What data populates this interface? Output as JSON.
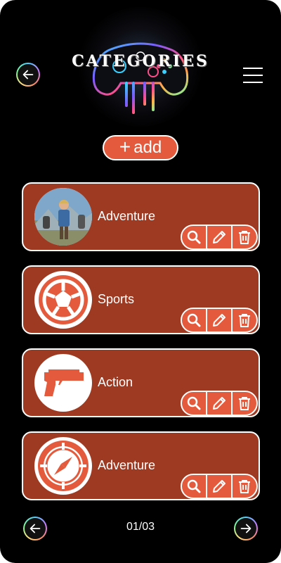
{
  "header": {
    "title": "CATEGORIES",
    "back_icon": "arrow-left-circle-icon",
    "menu_icon": "hamburger-menu-icon",
    "art": "gamepad-art"
  },
  "add_button": {
    "label": "add",
    "icon": "plus-icon"
  },
  "categories": [
    {
      "label": "Adventure",
      "icon": "hero-portrait-image"
    },
    {
      "label": "Sports",
      "icon": "soccer-ball-icon"
    },
    {
      "label": "Action",
      "icon": "pistol-icon"
    },
    {
      "label": "Adventure",
      "icon": "compass-icon"
    }
  ],
  "card_actions": [
    "search-icon",
    "edit-pencil-icon",
    "trash-icon"
  ],
  "pagination": {
    "text": "01/03",
    "prev_icon": "arrow-left-circle-icon",
    "next_icon": "arrow-right-circle-icon"
  },
  "colors": {
    "background": "#000000",
    "card": "#9e3a22",
    "accent": "#e45a3c",
    "text": "#ffffff"
  }
}
